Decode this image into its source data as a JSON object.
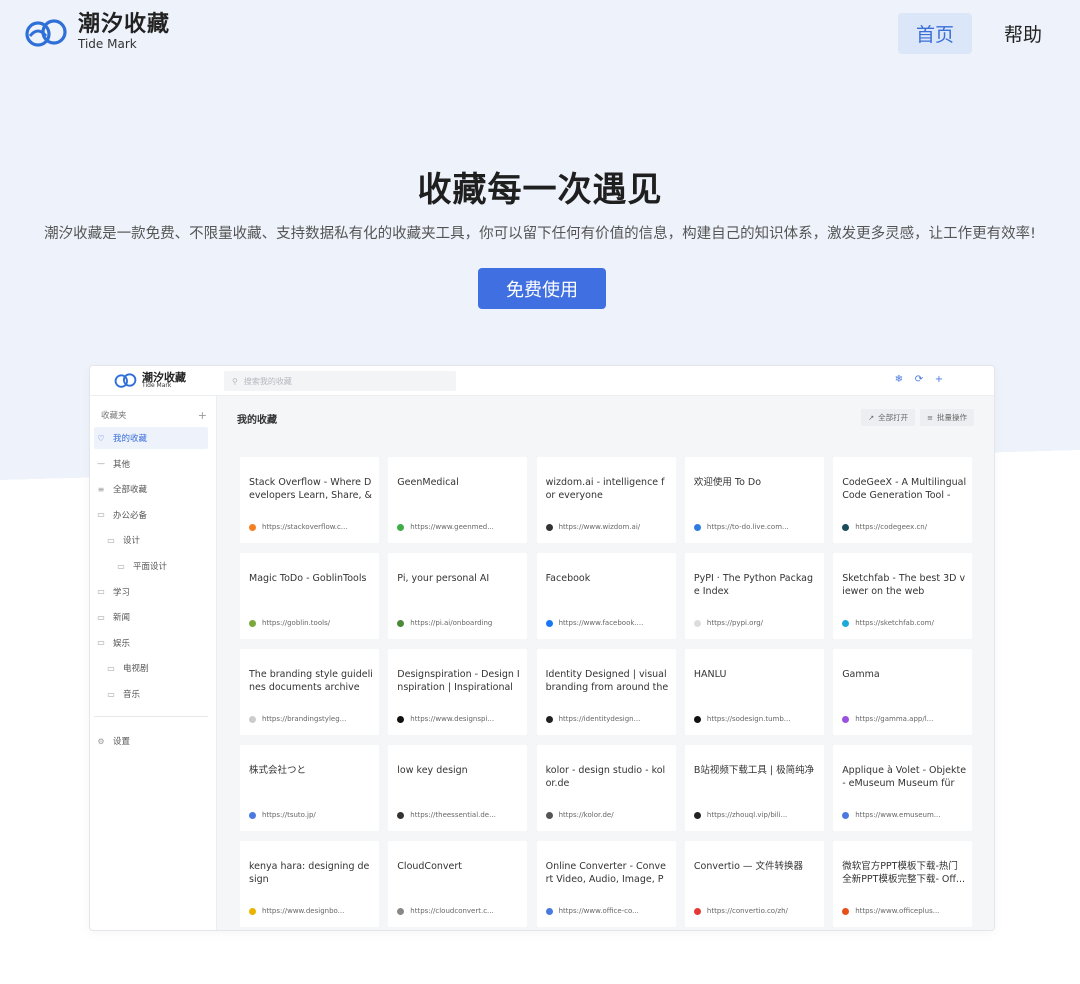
{
  "nav": {
    "brand_name": "潮汐收藏",
    "brand_sub": "Tide Mark",
    "home": "首页",
    "help": "帮助"
  },
  "hero": {
    "title": "收藏每一次遇见",
    "description": "潮汐收藏是一款免费、不限量收藏、支持数据私有化的收藏夹工具，你可以留下任何有价值的信息，构建自己的知识体系，激发更多灵感，让工作更有效率!",
    "cta": "免费使用"
  },
  "preview": {
    "brand_name": "潮汐收藏",
    "brand_sub": "Tide Mark",
    "search_placeholder": "搜索我的收藏",
    "tool_icons": [
      "snowflake-icon",
      "refresh-icon",
      "plus-icon"
    ],
    "sidebar": {
      "header": "收藏夹",
      "add": "+",
      "items": [
        {
          "label": "我的收藏",
          "icon": "heart-icon",
          "active": true
        },
        {
          "label": "其他",
          "icon": "dash-icon"
        },
        {
          "label": "全部收藏",
          "icon": "list-icon"
        },
        {
          "label": "办公必备",
          "icon": "folder-icon"
        },
        {
          "label": "设计",
          "icon": "folder-icon"
        },
        {
          "label": "平面设计",
          "icon": "folder-icon"
        },
        {
          "label": "学习",
          "icon": "folder-icon"
        },
        {
          "label": "新闻",
          "icon": "folder-icon"
        },
        {
          "label": "娱乐",
          "icon": "folder-icon"
        },
        {
          "label": "电视剧",
          "icon": "folder-icon"
        },
        {
          "label": "音乐",
          "icon": "folder-icon"
        }
      ],
      "settings": "设置"
    },
    "main": {
      "title": "我的收藏",
      "open_all": "全部打开",
      "batch": "批量操作",
      "cards": [
        {
          "title": "Stack Overflow - Where Developers Learn, Share, & ...",
          "url": "https://stackoverflow.c...",
          "color": "#f48024"
        },
        {
          "title": "GeenMedical",
          "url": "https://www.geenmed...",
          "color": "#3fae49"
        },
        {
          "title": "wizdom.ai - intelligence for everyone",
          "url": "https://www.wizdom.ai/",
          "color": "#333333"
        },
        {
          "title": "欢迎使用 To Do",
          "url": "https://to-do.live.com...",
          "color": "#2f7ce0"
        },
        {
          "title": "CodeGeeX - A Multilingual Code Generation Tool - C...",
          "url": "https://codegeex.cn/",
          "color": "#1a4d5c"
        },
        {
          "title": "Magic ToDo - GoblinTools",
          "url": "https://goblin.tools/",
          "color": "#7aa83a"
        },
        {
          "title": "Pi, your personal AI",
          "url": "https://pi.ai/onboarding",
          "color": "#4c8a3a"
        },
        {
          "title": "Facebook",
          "url": "https://www.facebook....",
          "color": "#1877f2"
        },
        {
          "title": "PyPI · The Python Package Index",
          "url": "https://pypi.org/",
          "color": "#dddddd"
        },
        {
          "title": "Sketchfab - The best 3D viewer on the web",
          "url": "https://sketchfab.com/",
          "color": "#1caad9"
        },
        {
          "title": "The branding style guidelines documents archive",
          "url": "https://brandingstyleg...",
          "color": "#cccccc"
        },
        {
          "title": "Designspiration - Design Inspiration | Inspirational ...",
          "url": "https://www.designspi...",
          "color": "#111111"
        },
        {
          "title": "Identity Designed | visual branding from around the ...",
          "url": "https://identitydesign...",
          "color": "#222222"
        },
        {
          "title": "HANLU",
          "url": "https://sodesign.tumb...",
          "color": "#111111"
        },
        {
          "title": "Gamma",
          "url": "https://gamma.app/l...",
          "color": "#9b51e0"
        },
        {
          "title": "株式会社つと",
          "url": "https://tsuto.jp/",
          "color": "#4a7ae0"
        },
        {
          "title": "low key design",
          "url": "https://theessential.de...",
          "color": "#333333"
        },
        {
          "title": "kolor - design studio - kolor.de",
          "url": "https://kolor.de/",
          "color": "#555555"
        },
        {
          "title": "B站视频下载工具 | 极简纯净",
          "url": "https://zhouql.vip/bili...",
          "color": "#222222"
        },
        {
          "title": "Applique à Volet - Objekte - eMuseum Museum für ...",
          "url": "https://www.emuseum...",
          "color": "#4a7ae0"
        },
        {
          "title": "kenya hara: designing design",
          "url": "https://www.designbo...",
          "color": "#e8b400"
        },
        {
          "title": "CloudConvert",
          "url": "https://cloudconvert.c...",
          "color": "#888888"
        },
        {
          "title": "Online Converter - Convert Video, Audio, Image, PDF...",
          "url": "https://www.office-co...",
          "color": "#4a7ae0"
        },
        {
          "title": "Convertio — 文件转换器",
          "url": "https://convertio.co/zh/",
          "color": "#e53935"
        },
        {
          "title": "微软官方PPT模板下载-热门全新PPT模板完整下载- Off...",
          "url": "https://www.officeplus...",
          "color": "#e8501a"
        }
      ]
    }
  }
}
